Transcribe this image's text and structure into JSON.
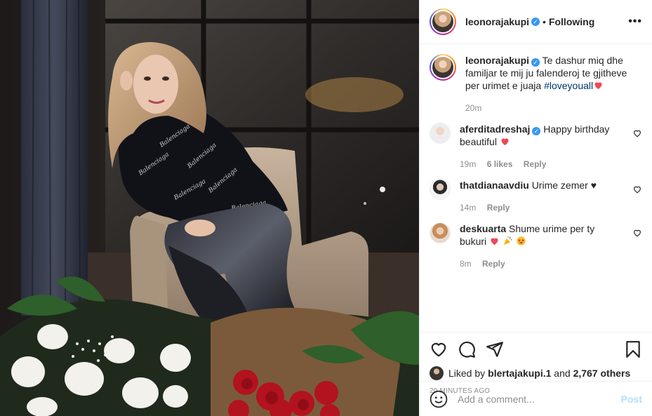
{
  "header": {
    "username": "leonorajakupi",
    "separator": "•",
    "follow_status": "Following",
    "more_icon": "ellipsis-icon"
  },
  "caption": {
    "username": "leonorajakupi",
    "text": "Te dashur miq dhe familjar te mij ju falenderoj te gjitheve per urimet e juaja ",
    "hashtag": "#loveyouall",
    "time": "20m"
  },
  "comments": [
    {
      "username": "aferditadreshaj",
      "verified": true,
      "text": "Happy birthday beautiful ",
      "time": "19m",
      "likes": "6 likes",
      "reply": "Reply"
    },
    {
      "username": "thatdianaavdiu",
      "verified": false,
      "text": "Urime zemer ♥",
      "time": "14m",
      "reply": "Reply"
    },
    {
      "username": "deskuarta",
      "verified": false,
      "text": "Shume urime per ty bukuri ",
      "time": "8m",
      "reply": "Reply"
    }
  ],
  "actions": {
    "liked_by_prefix": "Liked by ",
    "liked_by_user": "blertajakupi.1",
    "liked_by_mid": " and ",
    "others": "2,767 others",
    "timestamp": "20 MINUTES AGO"
  },
  "add_comment": {
    "placeholder": "Add a comment...",
    "post_label": "Post"
  },
  "colors": {
    "verified": "#3897f0",
    "heart_red": "#ed4956",
    "hashtag": "#00376b",
    "muted": "#8e8e8e",
    "post_disabled": "#b2dffc"
  }
}
